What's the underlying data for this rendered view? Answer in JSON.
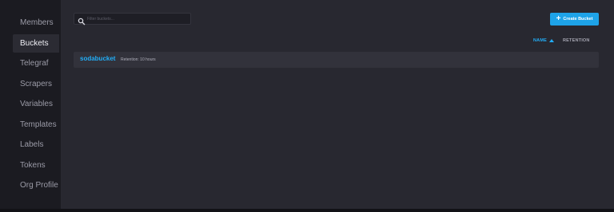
{
  "sidebar": {
    "items": [
      {
        "label": "Members"
      },
      {
        "label": "Buckets"
      },
      {
        "label": "Telegraf"
      },
      {
        "label": "Scrapers"
      },
      {
        "label": "Variables"
      },
      {
        "label": "Templates"
      },
      {
        "label": "Labels"
      },
      {
        "label": "Tokens"
      },
      {
        "label": "Org Profile"
      }
    ],
    "active": "Buckets"
  },
  "search": {
    "placeholder": "Filter buckets...",
    "icon": "search-icon"
  },
  "toolbar": {
    "create_label": "Create Bucket",
    "create_icon": "plus-icon"
  },
  "sort": {
    "name_label": "NAME",
    "retention_label": "RETENTION",
    "direction_icon": "caret-up-icon"
  },
  "buckets": [
    {
      "name": "sodabucket",
      "retention": "Retention: 10 hours"
    }
  ],
  "colors": {
    "accent": "#22adf6",
    "button": "#1ea3e8",
    "sidebar_bg": "#1b1b21",
    "main_bg": "#282830",
    "row_bg": "#32323b"
  }
}
